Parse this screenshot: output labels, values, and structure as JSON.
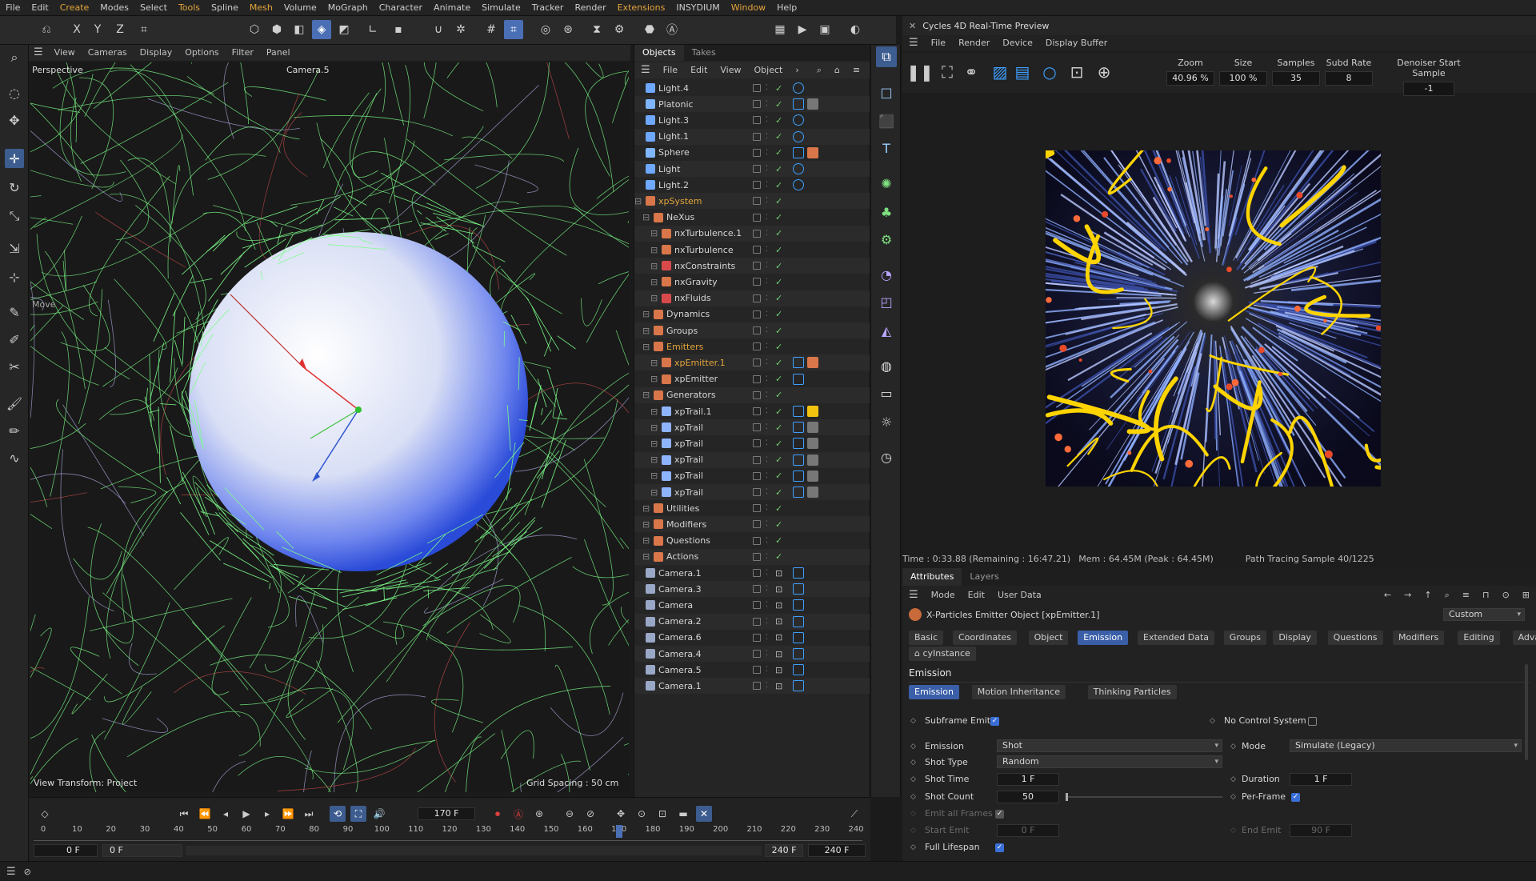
{
  "menubar": {
    "items": [
      "File",
      "Edit",
      "Create",
      "Modes",
      "Select",
      "Tools",
      "Spline",
      "Mesh",
      "Volume",
      "MoGraph",
      "Character",
      "Animate",
      "Simulate",
      "Tracker",
      "Render",
      "Extensions",
      "INSYDIUM",
      "Window",
      "Help"
    ],
    "highlighted": [
      "Create",
      "Tools",
      "Mesh",
      "Extensions",
      "Window"
    ]
  },
  "viewport": {
    "menu": [
      "View",
      "Cameras",
      "Display",
      "Options",
      "Filter",
      "Panel"
    ],
    "label": "Perspective",
    "camera": "Camera.5",
    "move_label": "Move",
    "view_transform": "View Transform: Project",
    "grid_spacing": "Grid Spacing : 50 cm"
  },
  "objects_panel": {
    "tabs": [
      "Objects",
      "Takes"
    ],
    "menu": [
      "File",
      "Edit",
      "View",
      "Object"
    ],
    "items": [
      {
        "name": "Light.4",
        "indent": 0,
        "kind": "light"
      },
      {
        "name": "Platonic",
        "indent": 0,
        "kind": "geo"
      },
      {
        "name": "Light.3",
        "indent": 0,
        "kind": "light"
      },
      {
        "name": "Light.1",
        "indent": 0,
        "kind": "light"
      },
      {
        "name": "Sphere",
        "indent": 0,
        "kind": "geo"
      },
      {
        "name": "Light",
        "indent": 0,
        "kind": "light"
      },
      {
        "name": "Light.2",
        "indent": 0,
        "kind": "light"
      },
      {
        "name": "xpSystem",
        "indent": 0,
        "kind": "xp",
        "highlight": true
      },
      {
        "name": "NeXus",
        "indent": 1,
        "kind": "xp"
      },
      {
        "name": "nxTurbulence.1",
        "indent": 2,
        "kind": "xp"
      },
      {
        "name": "nxTurbulence",
        "indent": 2,
        "kind": "xp"
      },
      {
        "name": "nxConstraints",
        "indent": 2,
        "kind": "xpr"
      },
      {
        "name": "nxGravity",
        "indent": 2,
        "kind": "xp"
      },
      {
        "name": "nxFluids",
        "indent": 2,
        "kind": "xpr"
      },
      {
        "name": "Dynamics",
        "indent": 1,
        "kind": "xp"
      },
      {
        "name": "Groups",
        "indent": 1,
        "kind": "xp"
      },
      {
        "name": "Emitters",
        "indent": 1,
        "kind": "xp",
        "highlight": true
      },
      {
        "name": "xpEmitter.1",
        "indent": 2,
        "kind": "xp",
        "highlight": true
      },
      {
        "name": "xpEmitter",
        "indent": 2,
        "kind": "xp"
      },
      {
        "name": "Generators",
        "indent": 1,
        "kind": "xp"
      },
      {
        "name": "xpTrail.1",
        "indent": 2,
        "kind": "trail"
      },
      {
        "name": "xpTrail",
        "indent": 2,
        "kind": "trail"
      },
      {
        "name": "xpTrail",
        "indent": 2,
        "kind": "trail"
      },
      {
        "name": "xpTrail",
        "indent": 2,
        "kind": "trail"
      },
      {
        "name": "xpTrail",
        "indent": 2,
        "kind": "trail"
      },
      {
        "name": "xpTrail",
        "indent": 2,
        "kind": "trail"
      },
      {
        "name": "Utilities",
        "indent": 1,
        "kind": "xp"
      },
      {
        "name": "Modifiers",
        "indent": 1,
        "kind": "xp"
      },
      {
        "name": "Questions",
        "indent": 1,
        "kind": "xp"
      },
      {
        "name": "Actions",
        "indent": 1,
        "kind": "xp"
      },
      {
        "name": "Camera.1",
        "indent": 0,
        "kind": "cam"
      },
      {
        "name": "Camera.3",
        "indent": 0,
        "kind": "cam"
      },
      {
        "name": "Camera",
        "indent": 0,
        "kind": "cam"
      },
      {
        "name": "Camera.2",
        "indent": 0,
        "kind": "cam"
      },
      {
        "name": "Camera.6",
        "indent": 0,
        "kind": "cam"
      },
      {
        "name": "Camera.4",
        "indent": 0,
        "kind": "cam"
      },
      {
        "name": "Camera.5",
        "indent": 0,
        "kind": "cam"
      },
      {
        "name": "Camera.1",
        "indent": 0,
        "kind": "cam"
      }
    ]
  },
  "render_preview": {
    "title": "Cycles 4D Real-Time Preview",
    "menu": [
      "File",
      "Render",
      "Device",
      "Display Buffer"
    ],
    "fields": [
      {
        "label": "Zoom",
        "value": "40.96 %"
      },
      {
        "label": "Size",
        "value": "100 %"
      },
      {
        "label": "Samples",
        "value": "35"
      },
      {
        "label": "Subd Rate",
        "value": "8"
      },
      {
        "label": "Denoiser Start Sample",
        "value": "-1"
      }
    ],
    "status_time": "Time : 0:33.88 (Remaining : 16:47.21)",
    "status_mem": "Mem : 64.45M (Peak : 64.45M)",
    "status_sample": "Path Tracing Sample 40/1225"
  },
  "attributes": {
    "tabs": [
      "Attributes",
      "Layers"
    ],
    "menu": [
      "Mode",
      "Edit",
      "User Data"
    ],
    "object_title": "X-Particles Emitter Object [xpEmitter.1]",
    "preset": "Custom",
    "main_tabs": [
      "Basic",
      "Coordinates",
      "Object",
      "Emission",
      "Extended Data",
      "Groups",
      "Display",
      "Questions",
      "Modifiers",
      "Editing",
      "Advanced"
    ],
    "active_main_tab": "Emission",
    "extra_tab": "cyInstance",
    "section": "Emission",
    "sub_tabs": [
      "Emission",
      "Motion Inheritance",
      "Thinking Particles"
    ],
    "subframe_emit": "Subframe Emit",
    "no_control_system": "No Control System",
    "emission_label": "Emission",
    "emission_value": "Shot",
    "mode_label": "Mode",
    "mode_value": "Simulate (Legacy)",
    "shot_type_label": "Shot Type",
    "shot_type_value": "Random",
    "shot_time_label": "Shot Time",
    "shot_time_value": "1 F",
    "duration_label": "Duration",
    "duration_value": "1 F",
    "shot_count_label": "Shot Count",
    "shot_count_value": "50",
    "per_frame_label": "Per-Frame",
    "emit_all_frames": "Emit all Frames",
    "start_emit_label": "Start Emit",
    "start_emit_value": "0 F",
    "end_emit_label": "End Emit",
    "end_emit_value": "90 F",
    "full_lifespan": "Full Lifespan"
  },
  "timeline": {
    "current_frame": "170 F",
    "ticks": [
      "0",
      "10",
      "20",
      "30",
      "40",
      "50",
      "60",
      "70",
      "80",
      "90",
      "100",
      "110",
      "120",
      "130",
      "140",
      "150",
      "160",
      "170",
      "180",
      "190",
      "200",
      "210",
      "220",
      "230",
      "240"
    ],
    "playhead_value": 170,
    "start_a": "0 F",
    "start_b": "0 F",
    "end_a": "240 F",
    "end_b": "240 F"
  },
  "colors": {
    "accent": "#3a5fa8",
    "highlight_orange": "#e4a53b",
    "check_green": "#6fd06f",
    "particle_green": "#7dff8a",
    "render_yellow": "#ffd400"
  }
}
